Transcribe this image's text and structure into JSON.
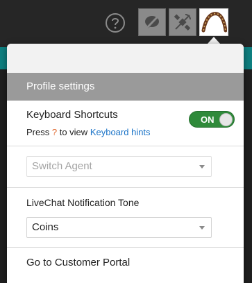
{
  "topbar": {
    "help_icon": "question-circle-icon",
    "tool1_icon": "bubble-slash-icon",
    "tool2_icon": "satellite-slash-icon",
    "avatar_icon": "avatar-image"
  },
  "colors": {
    "topbar": "#262626",
    "accent_strip": "#0e7f80",
    "header": "#9a9a9a",
    "toggle_on": "#2f8a3a",
    "link": "#1a73c7",
    "question_mark": "#e0662b"
  },
  "panel": {
    "header": "Profile settings",
    "keyboard": {
      "title": "Keyboard Shortcuts",
      "hint_prefix": "Press",
      "hint_key": "?",
      "hint_middle": "to view",
      "hint_link": "Keyboard hints",
      "toggle_label": "ON"
    },
    "switch_agent": {
      "value": "Switch Agent"
    },
    "tone": {
      "title": "LiveChat Notification Tone",
      "value": "Coins"
    },
    "portal_link": "Go to Customer Portal"
  }
}
